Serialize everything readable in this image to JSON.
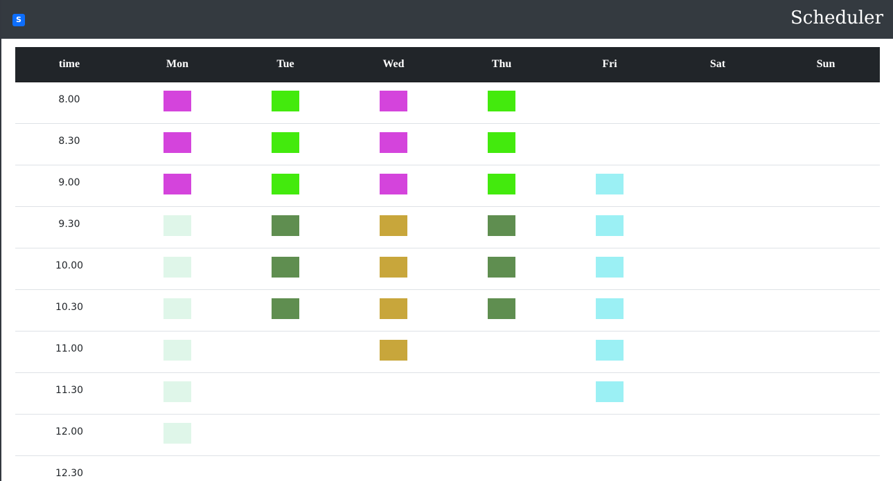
{
  "navbar": {
    "logo_letter": "S",
    "title": "Scheduler"
  },
  "colors": {
    "navbar_bg": "#343a40",
    "header_bg": "#212529",
    "magenta": "#d444dc",
    "bright_green": "#43ea0d",
    "mint": "#dff6e9",
    "dark_green": "#5f8e50",
    "gold": "#c8a63b",
    "aqua": "#9bf0f4"
  },
  "table": {
    "headers": [
      "time",
      "Mon",
      "Tue",
      "Wed",
      "Thu",
      "Fri",
      "Sat",
      "Sun"
    ],
    "rows": [
      {
        "time": "8.00",
        "slots": [
          "#d444dc",
          "#43ea0d",
          "#d444dc",
          "#43ea0d",
          "",
          "",
          ""
        ]
      },
      {
        "time": "8.30",
        "slots": [
          "#d444dc",
          "#43ea0d",
          "#d444dc",
          "#43ea0d",
          "",
          "",
          ""
        ]
      },
      {
        "time": "9.00",
        "slots": [
          "#d444dc",
          "#43ea0d",
          "#d444dc",
          "#43ea0d",
          "#9bf0f4",
          "",
          ""
        ]
      },
      {
        "time": "9.30",
        "slots": [
          "#dff6e9",
          "#5f8e50",
          "#c8a63b",
          "#5f8e50",
          "#9bf0f4",
          "",
          ""
        ]
      },
      {
        "time": "10.00",
        "slots": [
          "#dff6e9",
          "#5f8e50",
          "#c8a63b",
          "#5f8e50",
          "#9bf0f4",
          "",
          ""
        ]
      },
      {
        "time": "10.30",
        "slots": [
          "#dff6e9",
          "#5f8e50",
          "#c8a63b",
          "#5f8e50",
          "#9bf0f4",
          "",
          ""
        ]
      },
      {
        "time": "11.00",
        "slots": [
          "#dff6e9",
          "",
          "#c8a63b",
          "",
          "#9bf0f4",
          "",
          ""
        ]
      },
      {
        "time": "11.30",
        "slots": [
          "#dff6e9",
          "",
          "",
          "",
          "#9bf0f4",
          "",
          ""
        ]
      },
      {
        "time": "12.00",
        "slots": [
          "#dff6e9",
          "",
          "",
          "",
          "",
          "",
          ""
        ]
      },
      {
        "time": "12.30",
        "slots": [
          "",
          "",
          "",
          "",
          "",
          "",
          ""
        ]
      }
    ]
  }
}
